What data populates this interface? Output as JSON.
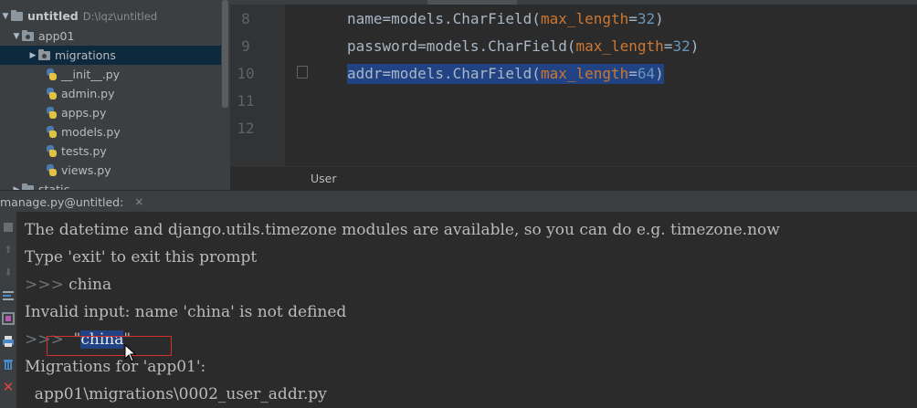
{
  "tree": {
    "root": {
      "name": "untitled",
      "path": "D:\\lqz\\untitled"
    },
    "app01": "app01",
    "migrations": "migrations",
    "files": [
      "__init__.py",
      "admin.py",
      "apps.py",
      "models.py",
      "tests.py",
      "views.py"
    ],
    "next_folder": "static"
  },
  "editor": {
    "line_numbers": [
      "8",
      "9",
      "10",
      "11",
      "12"
    ],
    "lines": [
      {
        "name": "name",
        "op": "=",
        "cls": "models.CharField(",
        "kw": "max_length",
        "eq": "=",
        "num": "32",
        "close": ")"
      },
      {
        "name": "password",
        "op": "=",
        "cls": "models.CharField(",
        "kw": "max_length",
        "eq": "=",
        "num": "32",
        "close": ")"
      },
      {
        "name": "addr",
        "op": "=",
        "cls": "models.CharField(",
        "kw": "max_length",
        "eq": "=",
        "num": "64",
        "close": ")"
      }
    ],
    "breadcrumb": "User"
  },
  "console": {
    "tab_label": "manage.py@untitled:",
    "close_glyph": "×",
    "prompt": ">>>",
    "lines": {
      "l1": "The datetime and django.utils.timezone modules are available, so you can do e.g. timezone.now",
      "l2": "Type 'exit' to exit this prompt",
      "l3_input": " china",
      "l4": "Invalid input: name 'china' is not defined",
      "l5_quote_open": "  \"",
      "l5_selected": "china",
      "l5_quote_close": "\"",
      "l6": "Migrations for 'app01':",
      "l7": "  app01\\migrations\\0002_user_addr.py"
    }
  },
  "colors": {
    "background": "#2b2b2b",
    "selection": "#214283",
    "keyword": "#cc7832",
    "number": "#6897bb",
    "highlight_box": "#d32f2f"
  },
  "icons": [
    "folder-icon",
    "python-file-icon",
    "console-stop-icon",
    "up-arrow-icon",
    "down-arrow-icon",
    "soft-wrap-icon",
    "scroll-end-icon",
    "print-icon",
    "trash-icon",
    "close-icon"
  ]
}
